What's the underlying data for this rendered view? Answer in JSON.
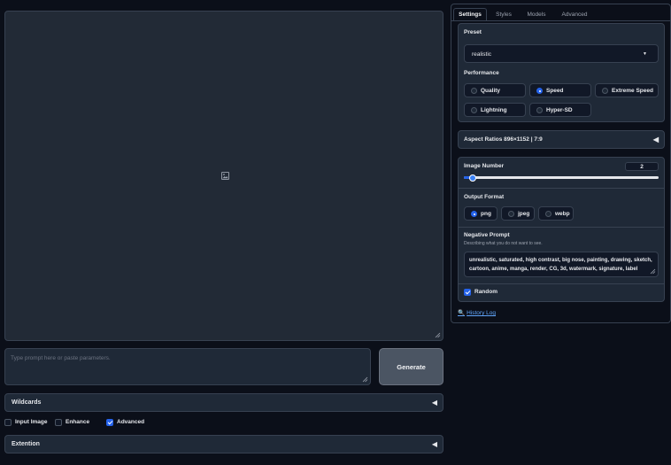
{
  "left": {
    "prompt_placeholder": "Type prompt here or paste parameters.",
    "generate_label": "Generate",
    "wildcards_label": "Wildcards",
    "extention_label": "Extention",
    "checkboxes": [
      {
        "label": "Input Image",
        "checked": false
      },
      {
        "label": "Enhance",
        "checked": false
      },
      {
        "label": "Advanced",
        "checked": true
      }
    ]
  },
  "tabs": [
    "Settings",
    "Styles",
    "Models",
    "Advanced"
  ],
  "active_tab": "Settings",
  "settings": {
    "preset_label": "Preset",
    "preset_value": "realistic",
    "performance_label": "Performance",
    "performance_options": [
      "Quality",
      "Speed",
      "Extreme Speed",
      "Lightning",
      "Hyper-SD"
    ],
    "performance_selected": "Speed",
    "aspect_ratios_label": "Aspect Ratios 896×1152 | 7:9",
    "image_number_label": "Image Number",
    "image_number_value": "2",
    "image_number_fraction": 0.03,
    "output_format_label": "Output Format",
    "output_formats": [
      "png",
      "jpeg",
      "webp"
    ],
    "output_format_selected": "png",
    "negative_prompt_label": "Negative Prompt",
    "negative_prompt_hint": "Describing what you do not want to see.",
    "negative_prompt_value": "unrealistic, saturated, high contrast, big nose, painting, drawing, sketch, cartoon, anime, manga, render, CG, 3d, watermark, signature, label",
    "random_label": "Random",
    "random_checked": true,
    "history_log_label": "History Log"
  },
  "colors": {
    "background": "#0b0f19",
    "panel": "#1f2937",
    "accent": "#2563eb",
    "link": "#60a5fa"
  }
}
